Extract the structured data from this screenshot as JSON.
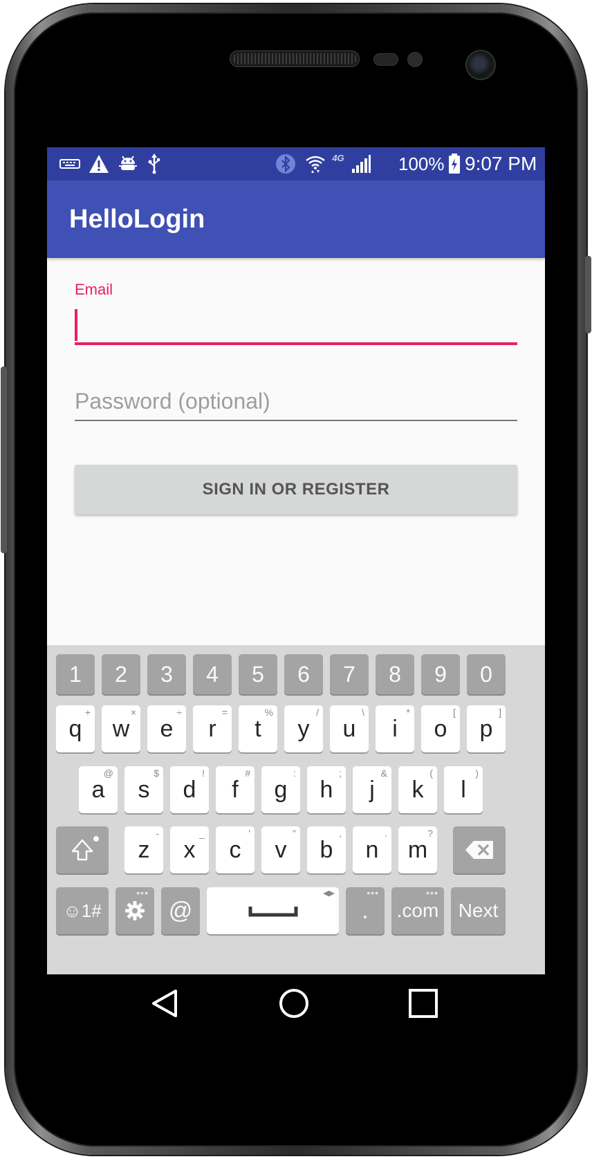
{
  "status_bar": {
    "battery_percent": "100%",
    "time": "9:07 PM",
    "icons": [
      "keyboard-icon",
      "warning-icon",
      "android-debug-icon",
      "usb-icon",
      "bluetooth-icon",
      "wifi-icon",
      "lte-icon",
      "signal-icon",
      "battery-charging-icon"
    ],
    "network_label": "4G"
  },
  "app_bar": {
    "title": "HelloLogin"
  },
  "form": {
    "email_label": "Email",
    "email_value": "",
    "password_placeholder": "Password (optional)",
    "signin_label": "SIGN IN OR REGISTER"
  },
  "keyboard": {
    "number_row": [
      "1",
      "2",
      "3",
      "4",
      "5",
      "6",
      "7",
      "8",
      "9",
      "0"
    ],
    "row1": [
      {
        "key": "q",
        "hint": "+"
      },
      {
        "key": "w",
        "hint": "×"
      },
      {
        "key": "e",
        "hint": "÷"
      },
      {
        "key": "r",
        "hint": "="
      },
      {
        "key": "t",
        "hint": "%"
      },
      {
        "key": "y",
        "hint": "/"
      },
      {
        "key": "u",
        "hint": "\\"
      },
      {
        "key": "i",
        "hint": "*"
      },
      {
        "key": "o",
        "hint": "["
      },
      {
        "key": "p",
        "hint": "]"
      }
    ],
    "row2": [
      {
        "key": "a",
        "hint": "@"
      },
      {
        "key": "s",
        "hint": "$"
      },
      {
        "key": "d",
        "hint": "!"
      },
      {
        "key": "f",
        "hint": "#"
      },
      {
        "key": "g",
        "hint": ":"
      },
      {
        "key": "h",
        "hint": ";"
      },
      {
        "key": "j",
        "hint": "&"
      },
      {
        "key": "k",
        "hint": "("
      },
      {
        "key": "l",
        "hint": ")"
      }
    ],
    "row3": [
      {
        "key": "z",
        "hint": "-"
      },
      {
        "key": "x",
        "hint": "_"
      },
      {
        "key": "c",
        "hint": "'"
      },
      {
        "key": "v",
        "hint": "\""
      },
      {
        "key": "b",
        "hint": ","
      },
      {
        "key": "n",
        "hint": "."
      },
      {
        "key": "m",
        "hint": "?"
      }
    ],
    "symbols_key": "☺1#",
    "at_key": "@",
    "period_key": ".",
    "dotcom_key": ".com",
    "next_key": "Next"
  },
  "colors": {
    "status_bar": "#303f9f",
    "app_bar": "#3f51b5",
    "accent": "#e91e63",
    "keyboard_bg": "#d7d7d7"
  }
}
